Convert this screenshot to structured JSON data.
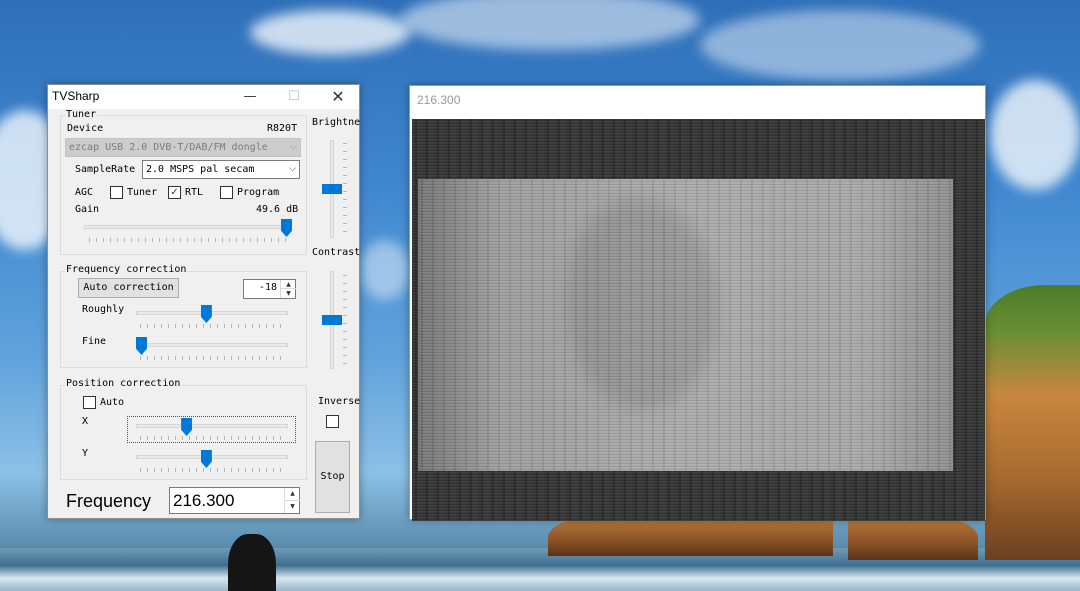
{
  "tvsharp": {
    "title": "TVSharp",
    "minimize_glyph": "—",
    "maximize_glyph": "☐",
    "close_glyph": "✕",
    "tuner": {
      "group_label": "Tuner",
      "device_label": "Device",
      "tuner_model": "R820T",
      "device_value": "ezcap USB 2.0 DVB-T/DAB/FM dongle",
      "samplerate_label": "SampleRate",
      "samplerate_value": "2.0 MSPS pal secam",
      "agc_label": "AGC",
      "agc_tuner_label": "Tuner",
      "agc_tuner_checked": false,
      "agc_rtl_label": "RTL",
      "agc_rtl_checked": true,
      "agc_program_label": "Program",
      "agc_program_checked": false,
      "gain_label": "Gain",
      "gain_value": "49.6 dB",
      "gain_slider_level": 1.0
    },
    "frequency_correction": {
      "group_label": "Frequency correction",
      "auto_button": "Auto correction",
      "correction_value": "-18",
      "roughly_label": "Roughly",
      "roughly_level": 0.46,
      "fine_label": "Fine",
      "fine_level": 0.0
    },
    "position_correction": {
      "group_label": "Position correction",
      "auto_label": "Auto",
      "auto_checked": false,
      "x_label": "X",
      "x_level": 0.32,
      "y_label": "Y",
      "y_level": 0.46
    },
    "brightness_label": "Brightness",
    "brightness_level": 0.5,
    "contrast_label": "Contrast",
    "contrast_level": 0.5,
    "inverse_label": "Inverse",
    "inverse_checked": false,
    "stop_button": "Stop",
    "frequency_label": "Frequency",
    "frequency_value": "216.300",
    "check_glyph": "✓",
    "dropdown_glyph": "⌵",
    "spin_up_glyph": "▲",
    "spin_down_glyph": "▼"
  },
  "video_window": {
    "title": "216.300"
  }
}
